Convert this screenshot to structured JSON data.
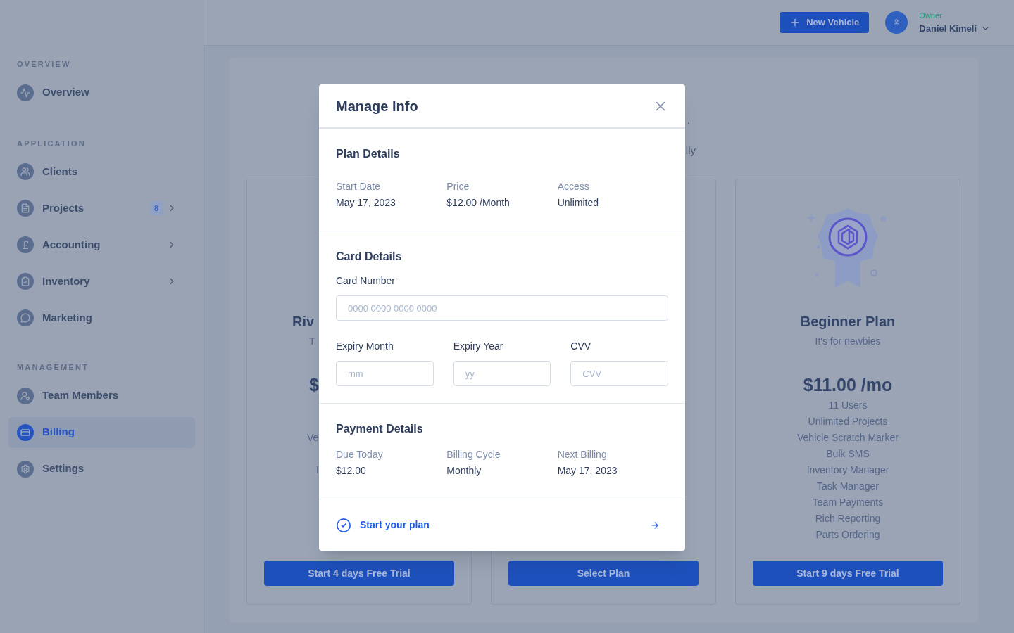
{
  "sidebar": {
    "sections": [
      {
        "heading": "OVERVIEW",
        "items": [
          {
            "label": "Overview",
            "selected": false,
            "expandable": false
          }
        ]
      },
      {
        "heading": "APPLICATION",
        "items": [
          {
            "label": "Clients",
            "selected": false,
            "expandable": false
          },
          {
            "label": "Projects",
            "selected": false,
            "expandable": true,
            "badge": "8"
          },
          {
            "label": "Accounting",
            "selected": false,
            "expandable": true
          },
          {
            "label": "Inventory",
            "selected": false,
            "expandable": true
          },
          {
            "label": "Marketing",
            "selected": false,
            "expandable": false
          }
        ]
      },
      {
        "heading": "MANAGEMENT",
        "items": [
          {
            "label": "Team Members",
            "selected": false,
            "expandable": false
          },
          {
            "label": "Billing",
            "selected": true,
            "expandable": false
          },
          {
            "label": "Settings",
            "selected": false,
            "expandable": false
          }
        ]
      }
    ]
  },
  "header": {
    "new_vehicle_button": "New Vehicle",
    "user": {
      "role": "Owner",
      "name": "Daniel Kimeli"
    }
  },
  "billing_page": {
    "intro_fragments": [
      ".",
      "lly"
    ],
    "plans": [
      {
        "kind": "partial",
        "title": "Riv",
        "subtitle": "T",
        "price": "$",
        "features": [
          "Ve",
          "I"
        ],
        "button": "Start 4 days Free Trial"
      },
      {
        "kind": "hidden",
        "button": "Select Plan"
      },
      {
        "kind": "full",
        "title": "Beginner Plan",
        "subtitle": "It's for newbies",
        "price": "$11.00 /mo",
        "features": [
          "11 Users",
          "Unlimited Projects",
          "Vehicle Scratch Marker",
          "Bulk SMS",
          "Inventory Manager",
          "Task Manager",
          "Team Payments",
          "Rich Reporting",
          "Parts Ordering"
        ],
        "button": "Start 9 days Free Trial"
      }
    ]
  },
  "modal": {
    "title": "Manage Info",
    "plan_details": {
      "heading": "Plan Details",
      "fields": [
        {
          "label": "Start Date",
          "value": "May 17, 2023"
        },
        {
          "label": "Price",
          "value": "$12.00 /Month"
        },
        {
          "label": "Access",
          "value": "Unlimited"
        }
      ]
    },
    "card_details": {
      "heading": "Card Details",
      "card_number": {
        "label": "Card Number",
        "placeholder": "0000 0000 0000 0000"
      },
      "fields": [
        {
          "label": "Expiry Month",
          "placeholder": "mm"
        },
        {
          "label": "Expiry Year",
          "placeholder": "yy"
        },
        {
          "label": "CVV",
          "placeholder": "CVV"
        }
      ]
    },
    "payment_details": {
      "heading": "Payment Details",
      "fields": [
        {
          "label": "Due Today",
          "value": "$12.00"
        },
        {
          "label": "Billing Cycle",
          "value": "Monthly"
        },
        {
          "label": "Next Billing",
          "value": "May 17, 2023"
        }
      ]
    },
    "footer_link": "Start your plan"
  }
}
